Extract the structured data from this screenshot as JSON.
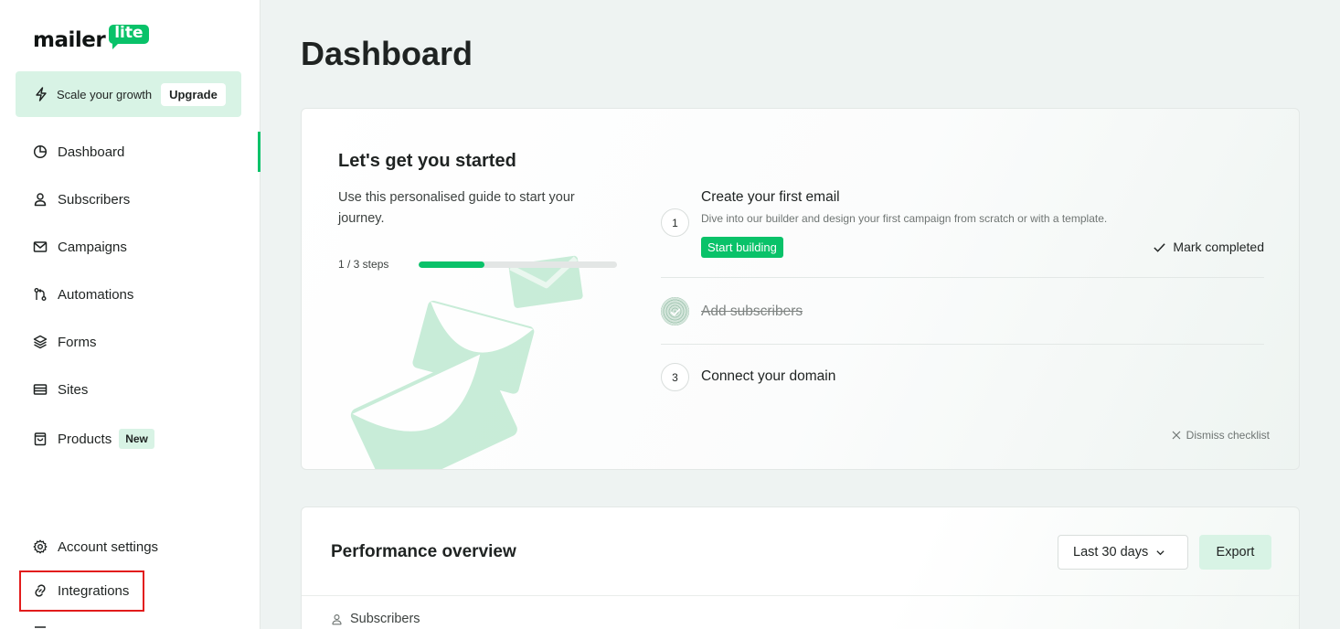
{
  "brand": {
    "word": "mailer",
    "bubble": "lite",
    "accent": "#09c269"
  },
  "promo": {
    "text": "Scale your growth",
    "button": "Upgrade"
  },
  "sidebar": {
    "items": [
      {
        "label": "Dashboard",
        "icon": "pie-chart-icon",
        "active": true
      },
      {
        "label": "Subscribers",
        "icon": "user-icon"
      },
      {
        "label": "Campaigns",
        "icon": "mail-icon"
      },
      {
        "label": "Automations",
        "icon": "automation-icon"
      },
      {
        "label": "Forms",
        "icon": "layers-icon"
      },
      {
        "label": "Sites",
        "icon": "browser-icon"
      },
      {
        "label": "Products",
        "icon": "shopping-bag-icon",
        "badge": "New"
      }
    ],
    "bottom": [
      {
        "label": "Account settings",
        "icon": "gear-icon"
      },
      {
        "label": "Integrations",
        "icon": "link-icon",
        "highlighted": true
      }
    ]
  },
  "page": {
    "title": "Dashboard"
  },
  "getting_started": {
    "title": "Let's get you started",
    "description": "Use this personalised guide to start your journey.",
    "progress_text": "1 / 3 steps",
    "progress_fraction": 0.333,
    "steps": [
      {
        "number": "1",
        "title": "Create your first email",
        "description": "Dive into our builder and design your first campaign from scratch or with a template.",
        "button": "Start building",
        "mark_completed": "Mark completed"
      },
      {
        "title": "Add subscribers",
        "completed": true
      },
      {
        "number": "3",
        "title": "Connect your domain"
      }
    ],
    "dismiss": "Dismiss checklist"
  },
  "performance": {
    "title": "Performance overview",
    "range": "Last 30 days",
    "export": "Export",
    "first_section": "Subscribers"
  }
}
